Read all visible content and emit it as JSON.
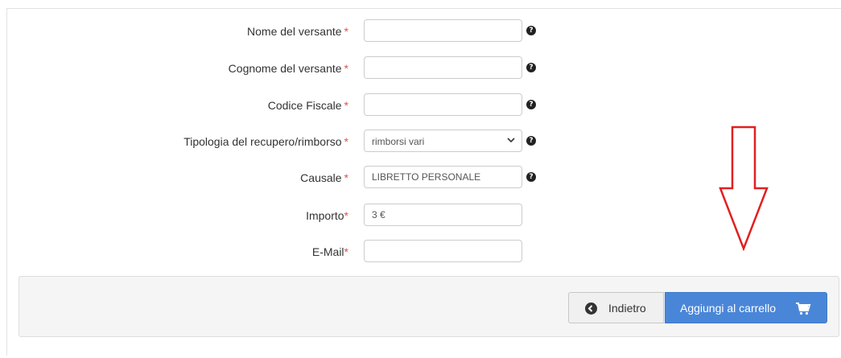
{
  "form": {
    "fields": [
      {
        "label": "Nome del versante",
        "required": true,
        "value": "",
        "help": true
      },
      {
        "label": "Cognome del versante",
        "required": true,
        "value": "",
        "help": true
      },
      {
        "label": "Codice Fiscale",
        "required": true,
        "value": "",
        "help": true
      },
      {
        "label": "Tipologia del recupero/rimborso",
        "required": true,
        "value": "rimborsi vari",
        "type": "select",
        "help": true
      },
      {
        "label": "Causale",
        "required": true,
        "value": "LIBRETTO PERSONALE",
        "help": true
      },
      {
        "label": "Importo",
        "required": true,
        "value": "3 €",
        "help": false
      },
      {
        "label": "E-Mail",
        "required": true,
        "value": "",
        "help": false
      }
    ],
    "required_marker": "*",
    "help_glyph": "?"
  },
  "footer": {
    "back_label": "Indietro",
    "add_label": "Aggiungi al carrello"
  },
  "annotation": {
    "arrow_color": "#e02020"
  }
}
